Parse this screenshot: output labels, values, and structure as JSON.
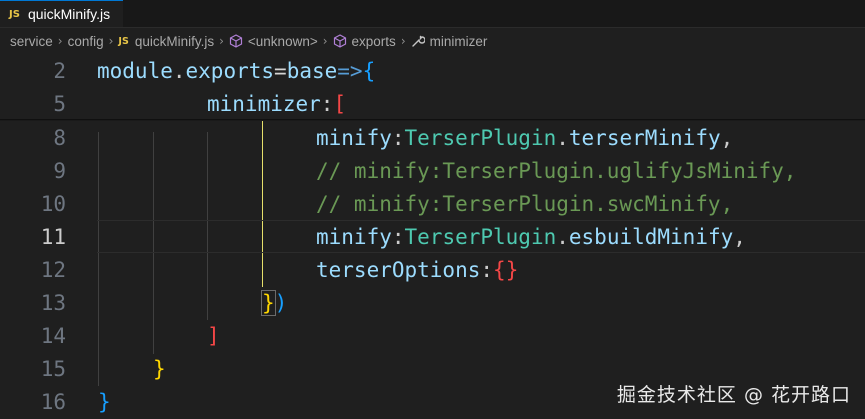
{
  "tab": {
    "badge": "JS",
    "label": "quickMinify.js"
  },
  "breadcrumb": {
    "items": [
      "service",
      "config",
      "quickMinify.js",
      "<unknown>",
      "exports",
      "minimizer"
    ],
    "js_badge": "JS",
    "icons": [
      "chevron-right",
      "chevron-right",
      "cube-icon",
      "cube-icon",
      "wrench-icon"
    ]
  },
  "editor": {
    "line_numbers": [
      "2",
      "5",
      "8",
      "9",
      "10",
      "11",
      "12",
      "13",
      "14",
      "15",
      "16"
    ],
    "active_line": "11",
    "lines": {
      "l2": {
        "a": "module",
        "b": ".",
        "c": "exports",
        "d": "=",
        "e": "base",
        "f": "=>",
        "g": "{"
      },
      "l5": {
        "a": "minimizer",
        "b": ":",
        "c": "["
      },
      "l8": {
        "a": "minify",
        "b": ":",
        "c": "TerserPlugin",
        "d": ".",
        "e": "terserMinify",
        "f": ","
      },
      "l9": {
        "a": "// minify:TerserPlugin.uglifyJsMinify,"
      },
      "l10": {
        "a": "// minify:TerserPlugin.swcMinify,"
      },
      "l11": {
        "a": "minify",
        "b": ":",
        "c": "TerserPlugin",
        "d": ".",
        "e": "esbuildMinify",
        "f": ","
      },
      "l12": {
        "a": "terserOptions",
        "b": ":",
        "c": "{",
        "d": "}"
      },
      "l13": {
        "a": "}",
        "b": ")"
      },
      "l14": {
        "a": "]"
      },
      "l15": {
        "a": "}"
      },
      "l16": {
        "a": "}"
      }
    }
  },
  "colors": {
    "background": "#1f1f1f",
    "keyword_blue": "#569cd6",
    "class_teal": "#4ec9b0",
    "function_yellow": "#dcdcaa",
    "comment_green": "#6a9955",
    "variable_lightblue": "#9cdcfe",
    "bracket_red": "#f44747",
    "bracket_gold": "#ffd700",
    "bracket_blue": "#179fff"
  },
  "watermark": {
    "text": "掘金技术社区 @ 花开路口"
  }
}
